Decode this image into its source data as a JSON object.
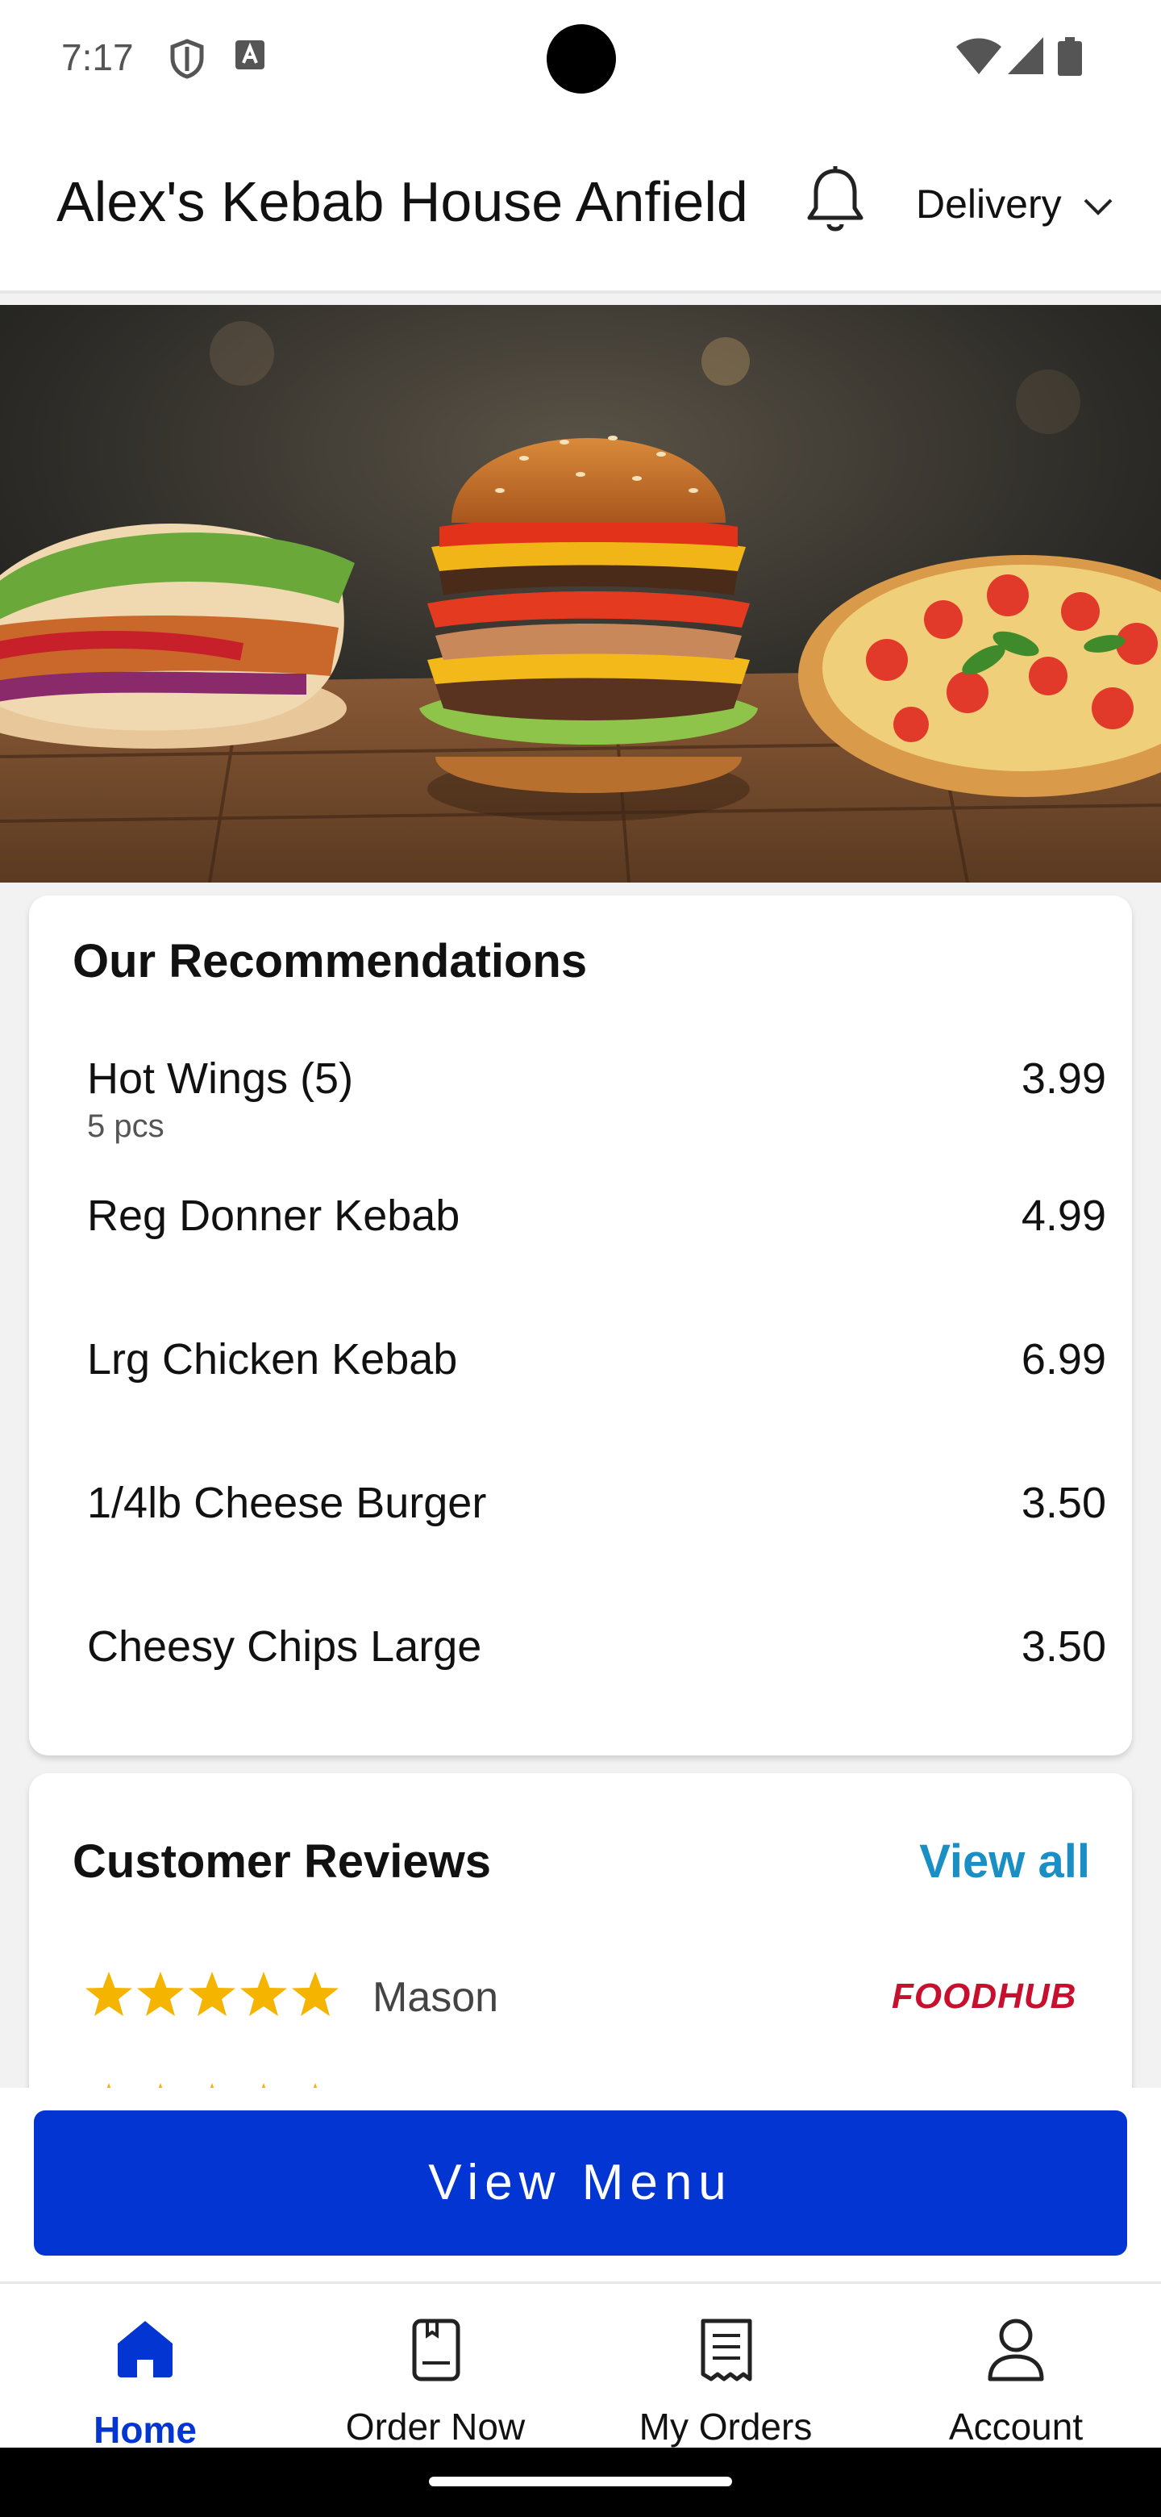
{
  "status_bar": {
    "time": "7:17"
  },
  "header": {
    "title": "Alex's Kebab House Anfield",
    "mode": "Delivery"
  },
  "recommendations": {
    "title": "Our Recommendations",
    "items": [
      {
        "name": "Hot Wings (5)",
        "sub": "5 pcs",
        "price": "3.99"
      },
      {
        "name": "Reg Donner Kebab",
        "sub": "",
        "price": "4.99"
      },
      {
        "name": "Lrg Chicken Kebab",
        "sub": "",
        "price": "6.99"
      },
      {
        "name": "1/4lb Cheese Burger",
        "sub": "",
        "price": "3.50"
      },
      {
        "name": "Cheesy Chips Large",
        "sub": "",
        "price": "3.50"
      }
    ]
  },
  "reviews": {
    "title": "Customer Reviews",
    "view_all": "View all",
    "items": [
      {
        "name": "Mason",
        "rating": 5,
        "source": "FOODHUB"
      }
    ]
  },
  "view_menu_label": "View Menu",
  "nav": {
    "items": [
      {
        "label": "Home",
        "icon": "home-icon",
        "active": true
      },
      {
        "label": "Order Now",
        "icon": "order-icon",
        "active": false
      },
      {
        "label": "My Orders",
        "icon": "receipt-icon",
        "active": false
      },
      {
        "label": "Account",
        "icon": "account-icon",
        "active": false
      }
    ]
  },
  "colors": {
    "primary": "#0335d3",
    "link": "#1a8fc4",
    "star": "#f5b400",
    "brand": "#c8102e"
  }
}
